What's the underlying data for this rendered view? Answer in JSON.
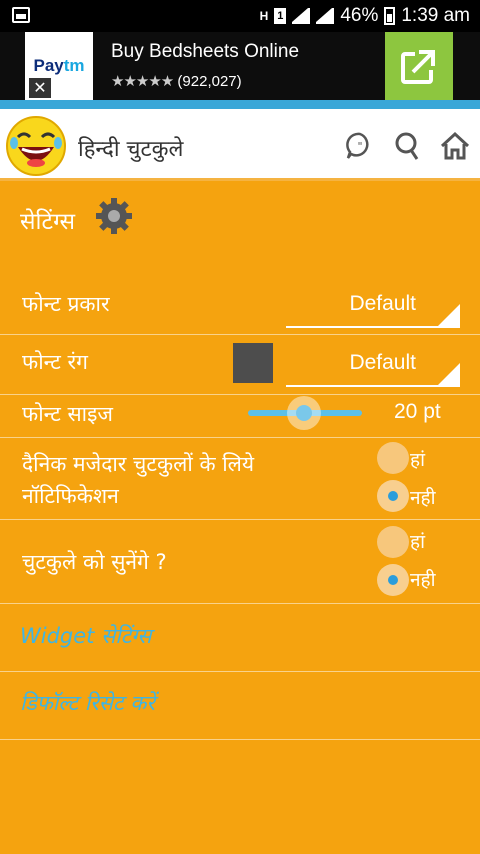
{
  "status_bar": {
    "network": "H",
    "sim": "1",
    "battery": "46%",
    "time": "1:39 am"
  },
  "ad": {
    "brand": "Paytm",
    "brand_colors": {
      "pay": "#0d2d7a",
      "tm": "#19a7e0"
    },
    "headline": "Buy Bedsheets Online",
    "stars": "★★★★★",
    "rating_count": "(922,027)",
    "close_label": "✕"
  },
  "app_bar": {
    "title": "हिन्दी चुटकुले",
    "icons": [
      "laughing-emoji-icon",
      "chat-quote-icon",
      "search-icon",
      "home-icon"
    ]
  },
  "settings": {
    "heading": "सेटिंग्स",
    "font_type": {
      "label": "फोन्ट प्रकार",
      "value": "Default"
    },
    "font_color": {
      "label": "फोन्ट रंग",
      "value": "Default",
      "swatch": "#4d4d4d"
    },
    "font_size": {
      "label": "फोन्ट साइज",
      "value": "20 pt"
    },
    "daily_notification": {
      "label_line1": "दैनिक मजेदार चुटकुलों के लिये",
      "label_line2": "नॉटिफिकेशन",
      "yes": "हां",
      "no": "नही",
      "selected": "no"
    },
    "listen_jokes": {
      "label": "चुटकुले को सुनेंगे ?",
      "yes": "हां",
      "no": "नही",
      "selected": "no"
    },
    "widget_settings": "Widget सेटिंग्स",
    "reset_default": "डिफॉल्ट रिसेट करें"
  },
  "colors": {
    "background": "#f5a30f",
    "accent": "#3aa7d8",
    "link": "#3fb5e3"
  }
}
